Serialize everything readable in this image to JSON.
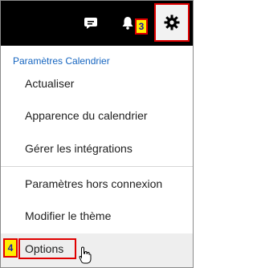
{
  "topbar": {
    "chat_icon": "chat-bubble-icon",
    "bell_icon": "bell-icon",
    "gear_icon": "gear-icon",
    "callout_3": "3"
  },
  "menu": {
    "section_title": "Paramètres Calendrier",
    "items": [
      {
        "label": "Actualiser"
      },
      {
        "label": "Apparence du calendrier"
      },
      {
        "label": "Gérer les intégrations"
      },
      {
        "label": "Paramètres hors connexion"
      },
      {
        "label": "Modifier le thème"
      }
    ],
    "options_label": "Options",
    "callout_4": "4"
  },
  "colors": {
    "topbar": "#000000",
    "accent_blue": "#1565c0",
    "highlight_red": "#e00000",
    "callout_yellow": "#ffee00"
  }
}
